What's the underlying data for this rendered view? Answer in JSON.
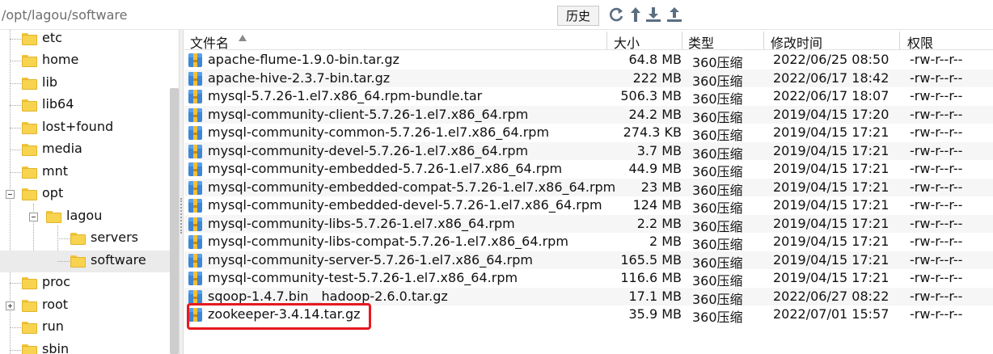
{
  "toolbar": {
    "path": "/opt/lagou/software",
    "history_label": "历史",
    "icons": [
      "refresh-icon",
      "up-arrow-icon",
      "download-icon",
      "upload-icon"
    ]
  },
  "tree": {
    "items": [
      {
        "label": "etc"
      },
      {
        "label": "home"
      },
      {
        "label": "lib"
      },
      {
        "label": "lib64"
      },
      {
        "label": "lost+found"
      },
      {
        "label": "media"
      },
      {
        "label": "mnt"
      },
      {
        "label": "opt"
      },
      {
        "label": "lagou"
      },
      {
        "label": "servers"
      },
      {
        "label": "software"
      },
      {
        "label": "proc"
      },
      {
        "label": "root"
      },
      {
        "label": "run"
      },
      {
        "label": "sbin"
      }
    ],
    "selected": "software"
  },
  "table": {
    "columns": [
      "文件名",
      "大小",
      "类型",
      "修改时间",
      "权限"
    ],
    "rows": [
      {
        "name": "apache-flume-1.9.0-bin.tar.gz",
        "size": "64.8 MB",
        "type": "360压缩",
        "time": "2022/06/25 08:50",
        "perm": "-rw-r--r--"
      },
      {
        "name": "apache-hive-2.3.7-bin.tar.gz",
        "size": "222 MB",
        "type": "360压缩",
        "time": "2022/06/17 18:42",
        "perm": "-rw-r--r--"
      },
      {
        "name": "mysql-5.7.26-1.el7.x86_64.rpm-bundle.tar",
        "size": "506.3 MB",
        "type": "360压缩",
        "time": "2022/06/17 18:07",
        "perm": "-rw-r--r--"
      },
      {
        "name": "mysql-community-client-5.7.26-1.el7.x86_64.rpm",
        "size": "24.2 MB",
        "type": "360压缩",
        "time": "2019/04/15 17:20",
        "perm": "-rw-r--r--"
      },
      {
        "name": "mysql-community-common-5.7.26-1.el7.x86_64.rpm",
        "size": "274.3 KB",
        "type": "360压缩",
        "time": "2019/04/15 17:21",
        "perm": "-rw-r--r--"
      },
      {
        "name": "mysql-community-devel-5.7.26-1.el7.x86_64.rpm",
        "size": "3.7 MB",
        "type": "360压缩",
        "time": "2019/04/15 17:21",
        "perm": "-rw-r--r--"
      },
      {
        "name": "mysql-community-embedded-5.7.26-1.el7.x86_64.rpm",
        "size": "44.9 MB",
        "type": "360压缩",
        "time": "2019/04/15 17:21",
        "perm": "-rw-r--r--"
      },
      {
        "name": "mysql-community-embedded-compat-5.7.26-1.el7.x86_64.rpm",
        "size": "23 MB",
        "type": "360压缩",
        "time": "2019/04/15 17:21",
        "perm": "-rw-r--r--"
      },
      {
        "name": "mysql-community-embedded-devel-5.7.26-1.el7.x86_64.rpm",
        "size": "124 MB",
        "type": "360压缩",
        "time": "2019/04/15 17:21",
        "perm": "-rw-r--r--"
      },
      {
        "name": "mysql-community-libs-5.7.26-1.el7.x86_64.rpm",
        "size": "2.2 MB",
        "type": "360压缩",
        "time": "2019/04/15 17:21",
        "perm": "-rw-r--r--"
      },
      {
        "name": "mysql-community-libs-compat-5.7.26-1.el7.x86_64.rpm",
        "size": "2 MB",
        "type": "360压缩",
        "time": "2019/04/15 17:21",
        "perm": "-rw-r--r--"
      },
      {
        "name": "mysql-community-server-5.7.26-1.el7.x86_64.rpm",
        "size": "165.5 MB",
        "type": "360压缩",
        "time": "2019/04/15 17:21",
        "perm": "-rw-r--r--"
      },
      {
        "name": "mysql-community-test-5.7.26-1.el7.x86_64.rpm",
        "size": "116.6 MB",
        "type": "360压缩",
        "time": "2019/04/15 17:21",
        "perm": "-rw-r--r--"
      },
      {
        "name": "sqoop-1.4.7.bin__hadoop-2.6.0.tar.gz",
        "size": "17.1 MB",
        "type": "360压缩",
        "time": "2022/06/27 08:22",
        "perm": "-rw-r--r--"
      },
      {
        "name": "zookeeper-3.4.14.tar.gz",
        "size": "35.9 MB",
        "type": "360压缩",
        "time": "2022/07/01 15:57",
        "perm": "-rw-r--r--"
      }
    ],
    "highlighted_row": "zookeeper-3.4.14.tar.gz",
    "highlight_color": "#e6191f"
  }
}
